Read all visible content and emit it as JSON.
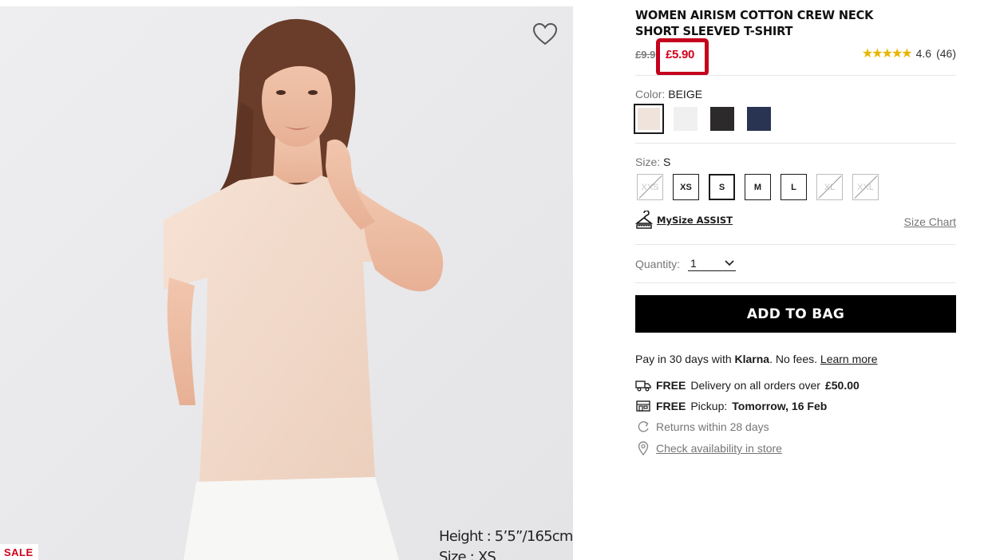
{
  "product": {
    "title": "WOMEN AIRISM COTTON CREW NECK SHORT SLEEVED T-SHIRT",
    "old_price": "£9.9",
    "new_price": "£5.90",
    "rating_value": 4.6,
    "rating_text": "4.6",
    "review_count": "(46)",
    "stars": "★★★★★"
  },
  "image": {
    "caption_height": "Height : 5’5”/165cm",
    "caption_size": "Size : XS",
    "sale_badge": "SALE",
    "wishlist_icon": "heart-outline-icon"
  },
  "color": {
    "label": "Color:",
    "value": "BEIGE",
    "swatches": [
      {
        "name": "beige",
        "hex": "#efe3dc",
        "selected": true
      },
      {
        "name": "off-white",
        "hex": "#f1f0f1",
        "selected": false
      },
      {
        "name": "black",
        "hex": "#2c2a2b",
        "selected": false
      },
      {
        "name": "navy",
        "hex": "#283452",
        "selected": false
      }
    ]
  },
  "size": {
    "label": "Size:",
    "value": "S",
    "options": [
      {
        "label": "XXS",
        "available": false,
        "selected": false
      },
      {
        "label": "XS",
        "available": true,
        "selected": false
      },
      {
        "label": "S",
        "available": true,
        "selected": true
      },
      {
        "label": "M",
        "available": true,
        "selected": false
      },
      {
        "label": "L",
        "available": true,
        "selected": false
      },
      {
        "label": "XL",
        "available": false,
        "selected": false
      },
      {
        "label": "XXL",
        "available": false,
        "selected": false
      }
    ],
    "mysize_label": "MySize ASSIST",
    "size_chart_label": "Size Chart"
  },
  "quantity": {
    "label": "Quantity:",
    "value": "1"
  },
  "add_to_bag_label": "ADD TO BAG",
  "klarna": {
    "prefix": "Pay in 30 days with",
    "brand": "Klarna",
    "suffix": ". No fees.",
    "link": "Learn more"
  },
  "delivery": {
    "free": "FREE",
    "text": "Delivery on all orders over",
    "amount": "£50.00"
  },
  "pickup": {
    "free": "FREE",
    "text": "Pickup:",
    "when": "Tomorrow, 16 Feb"
  },
  "returns_text": "Returns within 28 days",
  "store_link": "Check availability in store",
  "colors": {
    "sale_red": "#d0021b",
    "highlight_box": "#c4001c",
    "button_black": "#000000"
  }
}
